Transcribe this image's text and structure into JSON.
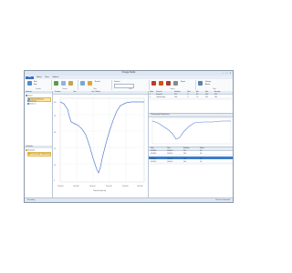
{
  "window": {
    "title": "Omega Studio"
  },
  "ribbon": {
    "file_label": "File",
    "tabs": [
      "Home",
      "View",
      "Options"
    ],
    "groups": [
      "Connect",
      "Record",
      "Tools",
      "View",
      "Export",
      "Help"
    ],
    "buttons": [
      "Connect",
      "Start",
      "Stop",
      "Record",
      "Export",
      "Settings",
      "Alarms"
    ]
  },
  "sidebar": {
    "devices_header": "Devices",
    "devices": [
      "Device",
      "Connected Device",
      "Device B",
      "Device C"
    ],
    "channels_header": "Channels",
    "channels": [
      "Channel 1",
      "Thermocouple Temperature"
    ]
  },
  "chart": {
    "toolbar": [
      "Duration",
      "Time",
      "Last 1 Minute"
    ],
    "xlabel": "Time (hh:mm:ss)",
    "xticks": [
      "14:00:00",
      "14:00:30",
      "14:01:00",
      "14:01:30",
      "14:02:00",
      "14:02:30"
    ],
    "yticks": [
      "30",
      "25",
      "20",
      "15",
      "10",
      "5"
    ]
  },
  "grid": {
    "columns": [
      "Index",
      "Channel",
      "Reading",
      "Units",
      "Min",
      "Max",
      "Average"
    ],
    "rows": [
      {
        "index": "1",
        "channel": "Channel 1",
        "reading": "25.1",
        "units": "°C",
        "min": "8.2",
        "max": "26.4",
        "avg": "18.7"
      },
      {
        "index": "2",
        "channel": "Thermocouple",
        "reading": "24.8",
        "units": "°C",
        "min": "7.9",
        "max": "25.9",
        "avg": "18.3"
      }
    ]
  },
  "minichart": {
    "title": "Thermocouple Temperature"
  },
  "log": {
    "columns": [
      "Date",
      "Time",
      "Reading",
      "Status"
    ],
    "rows": [
      [
        "1/1/2014",
        "14:00:10",
        "25.1",
        "OK"
      ],
      [
        "1/1/2014",
        "14:00:20",
        "24.9",
        "OK"
      ],
      [
        "1/1/2014",
        "14:00:30",
        "24.2",
        "OK"
      ],
      [
        "1/1/2014",
        "14:00:40",
        "22.8",
        "OK"
      ],
      [
        "1/1/2014",
        "14:00:50",
        "20.6",
        "OK"
      ]
    ]
  },
  "status": {
    "left": "Recording",
    "right": "1 Device Connected"
  }
}
